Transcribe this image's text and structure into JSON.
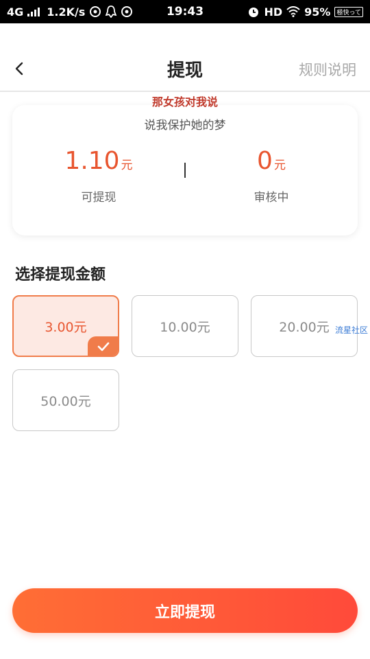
{
  "status_bar": {
    "network": "4G",
    "speed": "1.2K/s",
    "time": "19:43",
    "hd": "HD",
    "battery": "95%",
    "tag": "極快って"
  },
  "header": {
    "title": "提现",
    "rules_label": "规则说明"
  },
  "overlay": {
    "line1": "那女孩对我说",
    "line2": "说我保护她的梦",
    "watermark": "流星社区"
  },
  "balance": {
    "available_amount": "1.10",
    "available_unit": "元",
    "available_label": "可提现",
    "pending_amount": "0",
    "pending_unit": "元",
    "pending_label": "审核中"
  },
  "section_title": "选择提现金额",
  "amount_options": [
    {
      "label": "3.00元",
      "selected": true
    },
    {
      "label": "10.00元",
      "selected": false
    },
    {
      "label": "20.00元",
      "selected": false
    },
    {
      "label": "50.00元",
      "selected": false
    }
  ],
  "submit_label": "立即提现",
  "colors": {
    "accent": "#e8552f",
    "button_start": "#ff6e35",
    "button_end": "#ff4a3a",
    "selected_bg": "#fde9e3"
  }
}
